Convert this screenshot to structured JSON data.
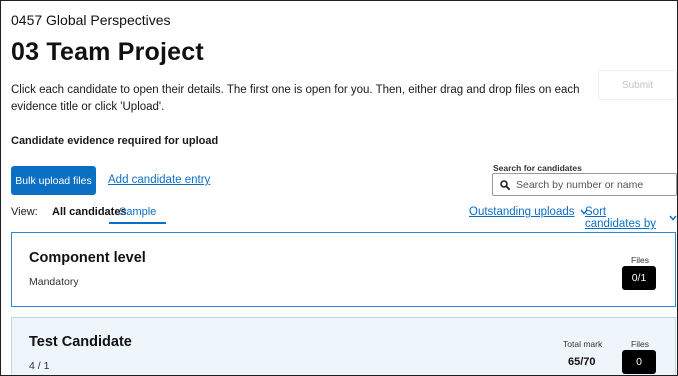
{
  "header": {
    "course": "0457 Global Perspectives",
    "title": "03 Team Project",
    "instructions": "Click each candidate to open their details. The first one is open for you. Then, either drag and drop files on each evidence title or click 'Upload'.",
    "submit_label": "Submit"
  },
  "evidence": {
    "heading": "Candidate evidence required for upload",
    "bulk_upload_label": "Bulk upload files",
    "add_candidate_label": "Add candidate entry"
  },
  "search": {
    "label": "Search for candidates",
    "placeholder": "Search by number or name"
  },
  "view": {
    "label": "View:",
    "tabs": [
      {
        "label": "All candidates",
        "active": false
      },
      {
        "label": "Sample",
        "active": true
      }
    ],
    "outstanding_label": "Outstanding uploads",
    "sort_label": "Sort candidates by"
  },
  "cards": {
    "component": {
      "title": "Component level",
      "subtitle": "Mandatory",
      "files_label": "Files",
      "files_value": "0/1"
    },
    "candidate": {
      "title": "Test Candidate",
      "subtitle": "4 / 1",
      "total_mark_label": "Total mark",
      "total_mark_value": "65/70",
      "files_label": "Files",
      "files_value": "0"
    }
  },
  "colors": {
    "accent": "#0b6fc4",
    "card_border_active": "#2b87d1",
    "card_bg_candidate": "#eef6fc",
    "badge_bg": "#000000"
  }
}
